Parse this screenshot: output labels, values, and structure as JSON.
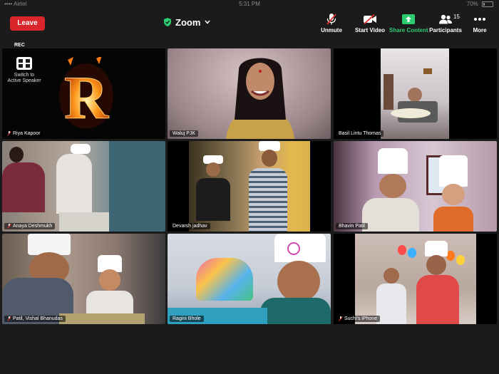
{
  "status_bar": {
    "carrier": "•••• Airtel",
    "time": "5:31 PM",
    "battery": "70%"
  },
  "header": {
    "leave_label": "Leave",
    "meeting_title": "Zoom",
    "tools": [
      {
        "label": "Unmute"
      },
      {
        "label": "Start Video"
      },
      {
        "label": "Share Content"
      },
      {
        "label": "Participants"
      },
      {
        "label": "More"
      }
    ],
    "participant_count": "15"
  },
  "recording": {
    "label": "REC"
  },
  "switch_view": {
    "label": "Switch to Active Speaker"
  },
  "tiles": [
    {
      "name": "Riya Kapoor",
      "muted": true,
      "avatar_letter": "R"
    },
    {
      "name": "Waluj PJK",
      "muted": false
    },
    {
      "name": "Basil Lintu Thomas",
      "muted": false
    },
    {
      "name": "Anaya Deshmukh",
      "muted": true
    },
    {
      "name": "Devarsh jadhav",
      "muted": false
    },
    {
      "name": "Bhavin Patil",
      "muted": false,
      "active": true
    },
    {
      "name": "Patil, Vishal Bhanudas",
      "muted": true
    },
    {
      "name": "Ragini Bhole",
      "muted": false
    },
    {
      "name": "Suchi's iPhone",
      "muted": true
    }
  ],
  "colors": {
    "leave": "#d8262a",
    "accent_green": "#2ecc71",
    "active_border": "#2ecc40",
    "background": "#1b1b1b"
  }
}
